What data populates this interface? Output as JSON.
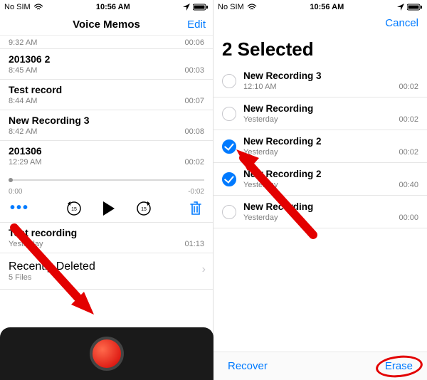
{
  "left": {
    "status": {
      "carrier": "No SIM",
      "time": "10:56 AM"
    },
    "nav": {
      "title": "Voice Memos",
      "edit": "Edit"
    },
    "firstRow": {
      "time": "9:32 AM",
      "dur": "00:06"
    },
    "memos": [
      {
        "title": "201306 2",
        "meta": "8:45 AM",
        "dur": "00:03"
      },
      {
        "title": "Test record",
        "meta": "8:44 AM",
        "dur": "00:07"
      },
      {
        "title": "New Recording 3",
        "meta": "8:42 AM",
        "dur": "00:08"
      },
      {
        "title": "201306",
        "meta": "12:29 AM",
        "dur": "00:02"
      }
    ],
    "scrub": {
      "left": "0:00",
      "right": "-0:02"
    },
    "extra": {
      "title": "Test recording",
      "meta": "Yesterday",
      "dur": "01:13"
    },
    "rd": {
      "title": "Recently Deleted",
      "sub": "5 Files"
    }
  },
  "right": {
    "status": {
      "carrier": "No SIM",
      "time": "10:56 AM"
    },
    "cancel": "Cancel",
    "heading": "2 Selected",
    "items": [
      {
        "title": "New Recording 3",
        "meta": "12:10 AM",
        "dur": "00:02",
        "checked": false
      },
      {
        "title": "New Recording",
        "meta": "Yesterday",
        "dur": "00:02",
        "checked": false
      },
      {
        "title": "New Recording 2",
        "meta": "Yesterday",
        "dur": "00:02",
        "checked": true
      },
      {
        "title": "New Recording 2",
        "meta": "Yesterday",
        "dur": "00:40",
        "checked": true
      },
      {
        "title": "New Recording",
        "meta": "Yesterday",
        "dur": "00:00",
        "checked": false
      }
    ],
    "toolbar": {
      "recover": "Recover",
      "erase": "Erase"
    }
  }
}
